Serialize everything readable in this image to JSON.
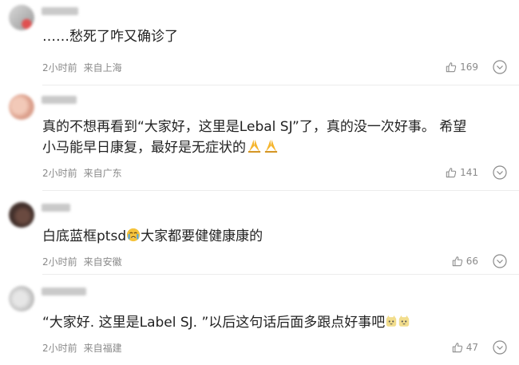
{
  "comments": [
    {
      "text": "……愁死了咋又确诊了",
      "time": "2小时前",
      "location": "来自上海",
      "likes": "169"
    },
    {
      "text": "真的不想再看到“大家好，这里是Lebal SJ”了，真的没一次好事。 希望小马能早日康复，最好是无症状的",
      "time": "2小时前",
      "location": "来自广东",
      "likes": "141"
    },
    {
      "text_before": "白底蓝框ptsd",
      "text_after": "大家都要健健康康的",
      "time": "2小时前",
      "location": "来自安徽",
      "likes": "66"
    },
    {
      "text": "“大家好. 这里是Label SJ. ”以后这句话后面多跟点好事吧",
      "time": "2小时前",
      "location": "来自福建",
      "likes": "47"
    }
  ],
  "icons": {
    "like": "thumbs-up-icon",
    "more": "more-circle-icon",
    "pray": "folded-hands-emoji",
    "cry": "crying-face-emoji",
    "cat": "cat-emoji"
  },
  "colors": {
    "text": "#222222",
    "meta": "#8a8a8a",
    "divider": "#ececec",
    "emoji_yellow": "#f5c33b"
  }
}
